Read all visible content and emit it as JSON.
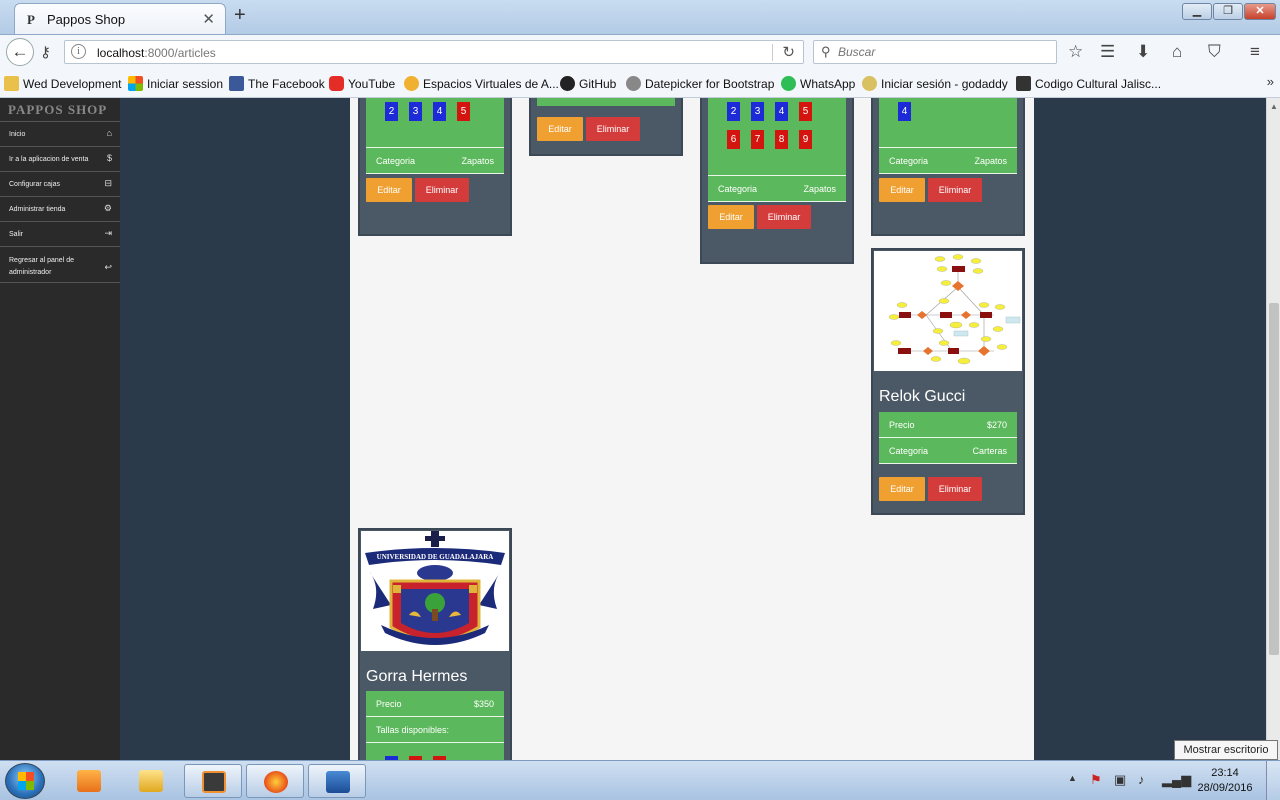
{
  "browser": {
    "tab_title": "Pappos Shop",
    "tab_favicon": "P",
    "url_host": "localhost",
    "url_path": ":8000/articles",
    "search_placeholder": "Buscar"
  },
  "bookmarks": [
    {
      "label": "Wed Development",
      "color": "#e8c04a"
    },
    {
      "label": "Iniciar session",
      "color": "#3a8ee6"
    },
    {
      "label": "The Facebook",
      "color": "#3b5998"
    },
    {
      "label": "YouTube",
      "color": "#e52d27"
    },
    {
      "label": "Espacios Virtuales de A...",
      "color": "#f0b030"
    },
    {
      "label": "GitHub",
      "color": "#222222"
    },
    {
      "label": "Datepicker for Bootstrap",
      "color": "#888888"
    },
    {
      "label": "WhatsApp",
      "color": "#2fbe55"
    },
    {
      "label": "Iniciar sesión - godaddy",
      "color": "#d9c060"
    },
    {
      "label": "Codigo Cultural Jalisc...",
      "color": "#333333"
    }
  ],
  "sidebar": {
    "brand": "PAPPOS SHOP",
    "items": [
      {
        "label": "Inicio",
        "icon": "⌂"
      },
      {
        "label": "Ir a la aplicacion de venta",
        "icon": "$"
      },
      {
        "label": "Configurar cajas",
        "icon": "⊟"
      },
      {
        "label": "Administrar tienda",
        "icon": "⚙"
      },
      {
        "label": "Salir",
        "icon": "⇥"
      },
      {
        "label": "Regresar al panel de administrador",
        "icon": "↩"
      }
    ]
  },
  "cards": {
    "c1": {
      "sizes": [
        "2",
        "3",
        "4",
        "5"
      ],
      "cat_label": "Categoria",
      "cat_value": "Zapatos",
      "edit": "Editar",
      "delete": "Eliminar"
    },
    "c2": {
      "edit": "Editar",
      "delete": "Eliminar"
    },
    "c3": {
      "sizes": [
        "2",
        "3",
        "4",
        "5",
        "6",
        "7",
        "8",
        "9"
      ],
      "cat_label": "Categoria",
      "cat_value": "Zapatos",
      "edit": "Editar",
      "delete": "Eliminar"
    },
    "c4": {
      "sizes": [
        "4"
      ],
      "cat_label": "Categoria",
      "cat_value": "Zapatos",
      "edit": "Editar",
      "delete": "Eliminar"
    },
    "c5": {
      "title": "Relok Gucci",
      "price_label": "Precio",
      "price_value": "$270",
      "cat_label": "Categoria",
      "cat_value": "Carteras",
      "edit": "Editar",
      "delete": "Eliminar"
    },
    "c6": {
      "title": "Gorra Hermes",
      "price_label": "Precio",
      "price_value": "$350",
      "sizes_label": "Tallas disponibles:",
      "logo_text": "UNIVERSIDAD DE GUADALAJARA"
    }
  },
  "tooltip": "Mostrar escritorio",
  "clock": {
    "time": "23:14",
    "date": "28/09/2016"
  },
  "colors": {
    "blue_size": "#1c2ad8",
    "red_size": "#d4150f",
    "green_row": "#5cb85c",
    "edit_btn": "#f0a030",
    "delete_btn": "#d43c3c"
  }
}
